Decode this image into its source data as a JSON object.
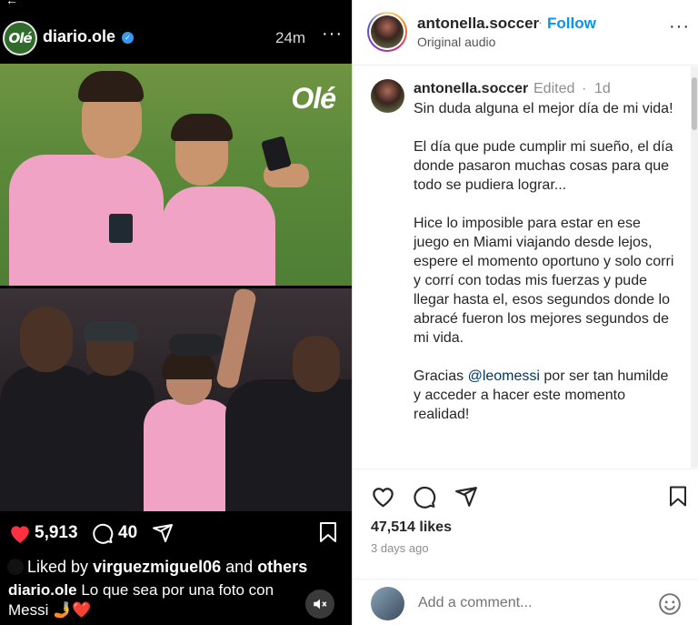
{
  "left_panel": {
    "account": "diario.ole",
    "avatar_text": "Olé",
    "time": "24m",
    "watermark": "Olé",
    "likes_count": "5,913",
    "comments_count": "40",
    "liked_by_prefix": "Liked by",
    "liked_by_user": "virguezmiguel06",
    "liked_by_and": "and",
    "liked_by_others": "others",
    "caption_user": "diario.ole",
    "caption_text": "Lo que sea por una foto con Messi 🤳❤️",
    "icons": [
      "verified-badge-icon",
      "more-icon",
      "heart-filled-icon",
      "comment-icon",
      "send-icon",
      "save-icon",
      "muted-speaker-icon"
    ]
  },
  "right_panel": {
    "header": {
      "username": "antonella.soccer",
      "separator": "·",
      "follow_label": "Follow",
      "subtitle": "Original audio"
    },
    "comment": {
      "username": "antonella.soccer",
      "edited": "Edited",
      "dot": "·",
      "age": "1d",
      "p1": "Sin duda alguna el mejor día de mi vida!",
      "p2": "El día que pude cumplir mi sueño, el día donde pasaron muchas cosas para que todo se pudiera lograr...",
      "p3": "Hice lo imposible para estar en ese juego en Miami viajando desde lejos, espere el momento oportuno y solo corri y corrí con todas mis fuerzas y pude llegar hasta el, esos segundos donde lo abracé fueron los mejores segundos de mi vida.",
      "p4_prefix": "Gracias",
      "p4_mention": "@leomessi",
      "p4_suffix": "por ser tan humilde y acceder a hacer este momento realidad!"
    },
    "likes": "47,514 likes",
    "date": "3 days ago",
    "add_comment_placeholder": "Add a comment...",
    "icons": [
      "heart-outline-icon",
      "comment-icon",
      "share-icon",
      "bookmark-icon",
      "emoji-icon",
      "more-options-icon"
    ]
  },
  "colors": {
    "follow_blue": "#0095f6",
    "heart_red": "#ff3040",
    "mention_blue": "#00376b",
    "verified_blue": "#3897f0"
  }
}
